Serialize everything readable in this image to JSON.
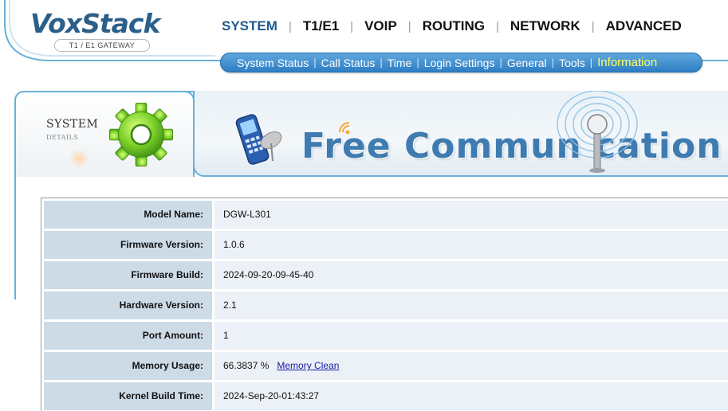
{
  "logo": {
    "name": "VoxStack",
    "subtitle": "T1 / E1 GATEWAY"
  },
  "main_nav": {
    "items": [
      {
        "label": "SYSTEM",
        "active": true
      },
      {
        "label": "T1/E1",
        "active": false
      },
      {
        "label": "VOIP",
        "active": false
      },
      {
        "label": "ROUTING",
        "active": false
      },
      {
        "label": "NETWORK",
        "active": false
      },
      {
        "label": "ADVANCED",
        "active": false
      }
    ]
  },
  "sub_nav": {
    "items": [
      {
        "label": "System Status",
        "active": false
      },
      {
        "label": "Call Status",
        "active": false
      },
      {
        "label": "Time",
        "active": false
      },
      {
        "label": "Login Settings",
        "active": false
      },
      {
        "label": "General",
        "active": false
      },
      {
        "label": "Tools",
        "active": false
      },
      {
        "label": "Information",
        "active": true
      }
    ]
  },
  "banner": {
    "section_title": "SYSTEM",
    "section_subtitle": "DETAILS",
    "slogan": "Free Commun   cation"
  },
  "info_table": {
    "rows": [
      {
        "label": "Model Name:",
        "value": "DGW-L301"
      },
      {
        "label": "Firmware Version:",
        "value": "1.0.6"
      },
      {
        "label": "Firmware Build:",
        "value": "2024-09-20-09-45-40"
      },
      {
        "label": "Hardware Version:",
        "value": "2.1"
      },
      {
        "label": "Port Amount:",
        "value": "1"
      },
      {
        "label": "Memory Usage:",
        "value": "66.3837 %",
        "link": "Memory Clean"
      },
      {
        "label": "Kernel Build Time:",
        "value": "2024-Sep-20-01:43:27"
      }
    ]
  },
  "colors": {
    "accent": "#2f7ec4",
    "active_main": "#1e5a8f",
    "active_sub": "#ffff66",
    "label_bg": "#cddbe7",
    "value_bg": "#ebf1f6",
    "link": "#1a1aa6"
  },
  "icons": {
    "gear": "gear-icon",
    "phone": "mobile-phone-icon",
    "antenna": "antenna-icon",
    "signal": "signal-icon"
  }
}
